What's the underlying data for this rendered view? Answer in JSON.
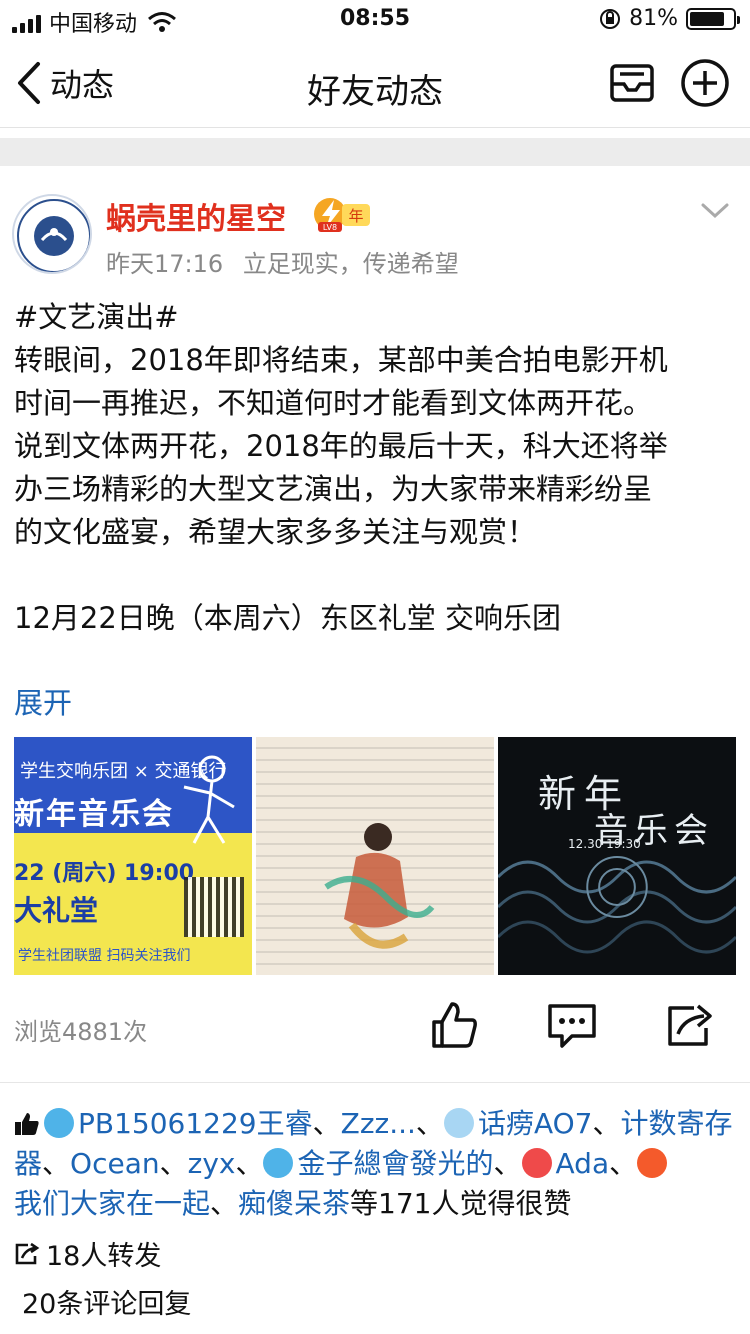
{
  "status_bar": {
    "carrier": "中国移动",
    "time": "08:55",
    "battery": "81%",
    "battery_level": 0.81
  },
  "nav": {
    "back_label": "动态",
    "title": "好友动态"
  },
  "post": {
    "author": "蜗壳里的星空",
    "badge_text": "年",
    "badge_level": "LV8",
    "time": "昨天17:16",
    "signature": "立足现实，传递希望",
    "body_lines": [
      "#文艺演出#",
      "转眼间，2018年即将结束，某部中美合拍电影开机",
      "时间一再推迟，不知道何时才能看到文体两开花。",
      "说到文体两开花，2018年的最后十天，科大还将举",
      "办三场精彩的大型文艺演出，为大家带来精彩纷呈",
      "的文化盛宴，希望大家多多关注与观赏！",
      "",
      "12月22日晚（本周六）东区礼堂 交响乐团"
    ],
    "expand_label": "展开",
    "images": {
      "img1": {
        "line1": "学生交响乐团 × 交通银行",
        "line2": "新年音乐会",
        "line3": "22 (周六) 19:00",
        "line4": "大礼堂",
        "footer": "学生社团联盟 扫码关注我们"
      },
      "img3": {
        "title": "新年",
        "subtitle": "音乐会",
        "time": "12.30 19:30"
      }
    },
    "views": "浏览4881次"
  },
  "likes": {
    "names": [
      "PB15061229王睿",
      "Zzz...",
      "话痨AO7",
      "计数寄存器",
      "Ocean",
      "zyx",
      "金子總會發光的",
      "Ada",
      "我们大家在一起",
      "痴傻呆茶"
    ],
    "separator": "、",
    "suffix": "等171人觉得很赞"
  },
  "reposts": "18人转发",
  "comments": "20条评论回复",
  "colors": {
    "link": "#1c64b4",
    "author": "#e0301e",
    "muted": "#888888"
  }
}
